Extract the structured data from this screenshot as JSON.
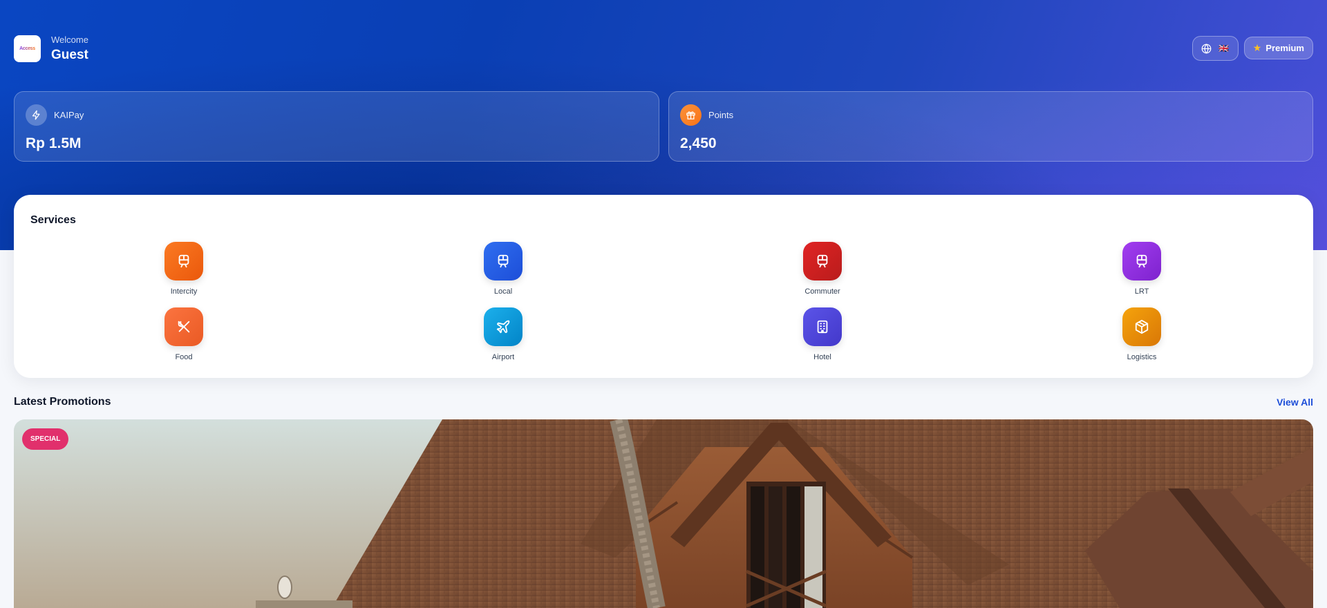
{
  "header": {
    "welcome_label": "Welcome",
    "user_name": "Guest",
    "logo_text": "Access"
  },
  "top_actions": {
    "language_icon": "globe-icon",
    "flag": "🇬🇧",
    "premium_label": "Premium",
    "premium_icon": "star-icon"
  },
  "cards": {
    "kaipay": {
      "label": "KAIPay",
      "value": "Rp 1.5M",
      "icon": "lightning-icon"
    },
    "points": {
      "label": "Points",
      "value": "2,450",
      "icon": "gift-icon"
    }
  },
  "services": {
    "title": "Services",
    "items": [
      {
        "label": "Intercity",
        "icon": "train-icon",
        "color": "#f97316"
      },
      {
        "label": "Local",
        "icon": "train-icon",
        "color": "#2563eb"
      },
      {
        "label": "Commuter",
        "icon": "train-icon",
        "color": "#dc2626"
      },
      {
        "label": "LRT",
        "icon": "train-icon",
        "color": "#9333ea"
      },
      {
        "label": "Food",
        "icon": "utensils-icon",
        "color": "#f26a2e"
      },
      {
        "label": "Airport",
        "icon": "plane-icon",
        "color": "#0ea5e9"
      },
      {
        "label": "Hotel",
        "icon": "building-icon",
        "color": "#4f46e5"
      },
      {
        "label": "Logistics",
        "icon": "package-icon",
        "color": "#f59e0b"
      }
    ]
  },
  "promotions": {
    "title": "Latest Promotions",
    "view_all": "View All",
    "badge": "SPECIAL"
  }
}
